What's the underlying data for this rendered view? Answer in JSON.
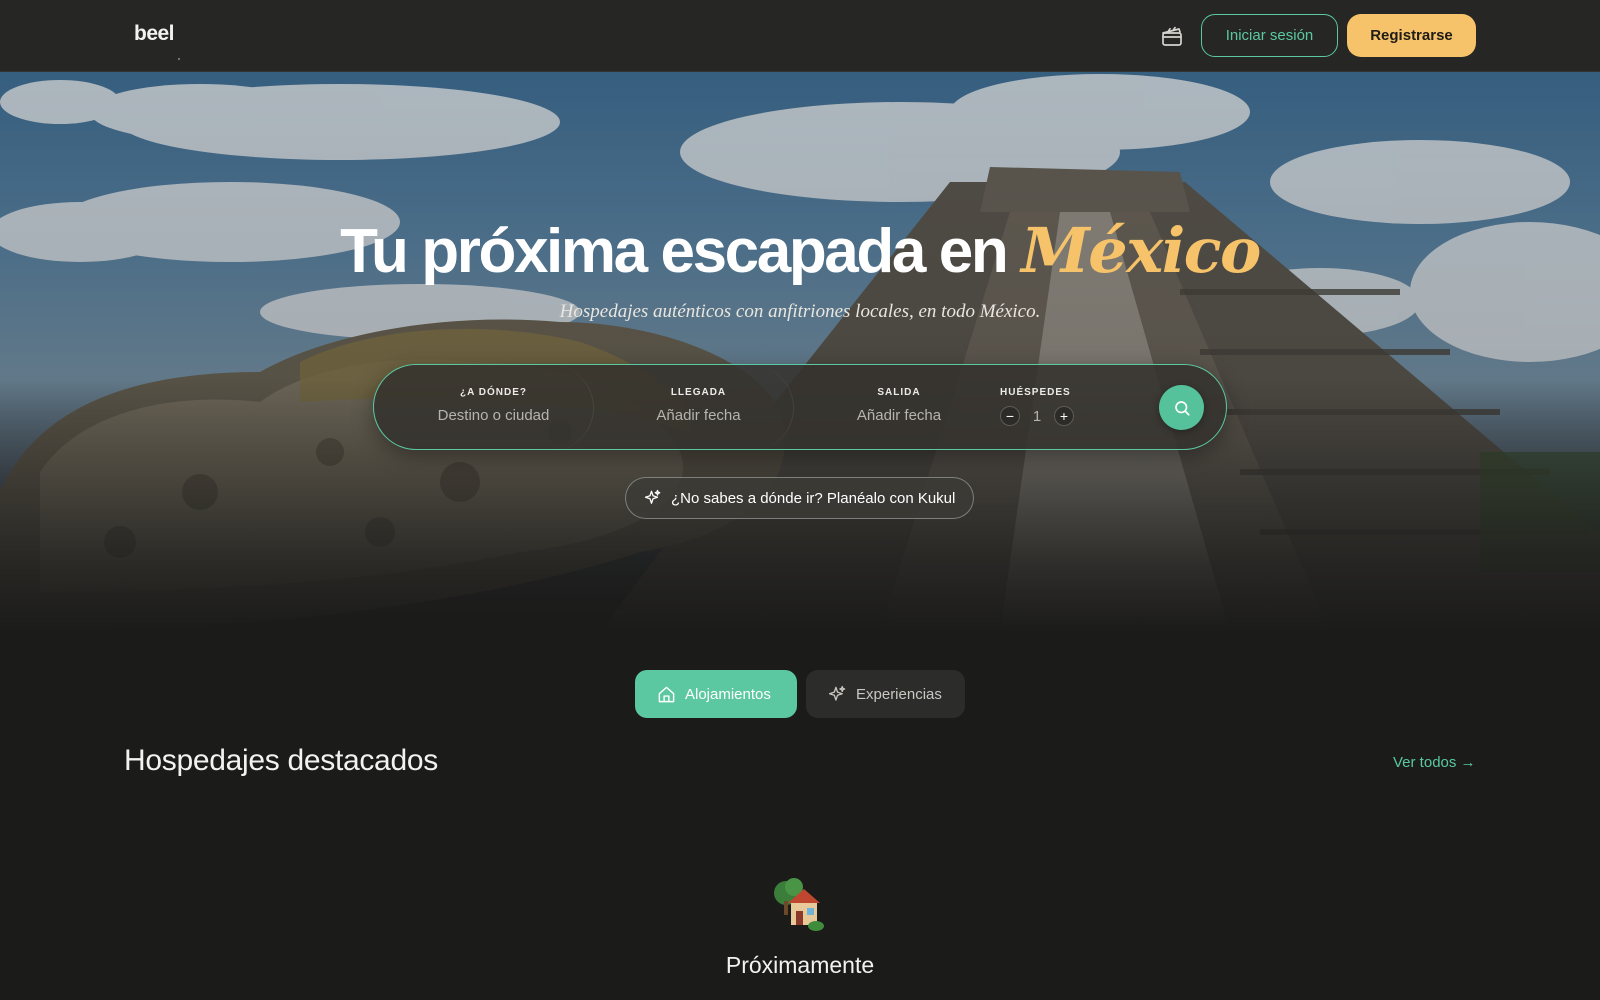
{
  "header": {
    "logo": "beel",
    "clapperboard_icon": "clapperboard-icon",
    "login_label": "Iniciar sesión",
    "signup_label": "Registrarse"
  },
  "hero": {
    "title_main": "Tu próxima escapada en ",
    "title_accent": "México",
    "subtitle": "Hospedajes auténticos con anfitriones locales, en todo México.",
    "search": {
      "where_label": "¿A DÓNDE?",
      "where_placeholder": "Destino o ciudad",
      "arrival_label": "LLEGADA",
      "arrival_placeholder": "Añadir fecha",
      "departure_label": "SALIDA",
      "departure_placeholder": "Añadir fecha",
      "guests_label": "HUÉSPEDES",
      "guests_minus": "−",
      "guests_value": "1",
      "guests_plus": "+",
      "search_icon": "search-icon"
    },
    "kukul_label": "¿No sabes a dónde ir? Planéalo con Kukul",
    "kukul_icon": "sparkles-icon"
  },
  "tabs": [
    {
      "label": "Alojamientos",
      "icon": "house-icon",
      "active": true
    },
    {
      "label": "Experiencias",
      "icon": "sparkles-icon",
      "active": false
    }
  ],
  "featured": {
    "title": "Hospedajes destacados",
    "see_all": "Ver todos →",
    "empty_icon": "house-with-garden-emoji",
    "empty_text": "Próximamente"
  },
  "colors": {
    "background": "#1b1b1a",
    "header_bg": "#262624",
    "accent_green": "#5bc8a2",
    "accent_yellow": "#f6c36a"
  }
}
